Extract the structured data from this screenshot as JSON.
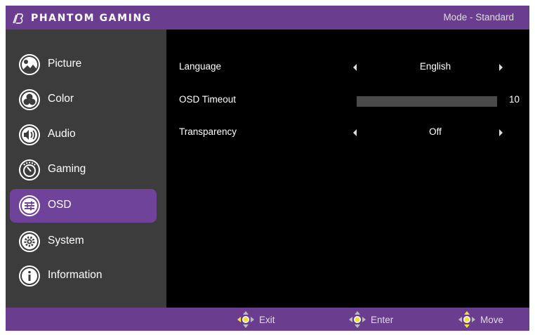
{
  "header": {
    "brand": "PHANTOM GAMING",
    "mode": "Mode - Standard"
  },
  "sidebar": {
    "items": [
      {
        "label": "Picture",
        "icon": "picture-icon",
        "active": false
      },
      {
        "label": "Color",
        "icon": "color-icon",
        "active": false
      },
      {
        "label": "Audio",
        "icon": "speaker-icon",
        "active": false
      },
      {
        "label": "Gaming",
        "icon": "gaming-icon",
        "active": false
      },
      {
        "label": "OSD",
        "icon": "sliders-icon",
        "active": true
      },
      {
        "label": "System",
        "icon": "gear-icon",
        "active": false
      },
      {
        "label": "Information",
        "icon": "info-icon",
        "active": false
      }
    ]
  },
  "settings": {
    "language": {
      "label": "Language",
      "value": "English"
    },
    "timeout": {
      "label": "OSD Timeout",
      "value": "10",
      "level": 1.0
    },
    "transparency": {
      "label": "Transparency",
      "value": "Off"
    }
  },
  "footer": {
    "exit": "Exit",
    "enter": "Enter",
    "move": "Move"
  },
  "colors": {
    "accent": "#6b3d8f",
    "active_item": "#70439a",
    "sidebar_bg": "#3c3c3c",
    "content_bg": "#000000",
    "joystick": "#f2e03a"
  }
}
